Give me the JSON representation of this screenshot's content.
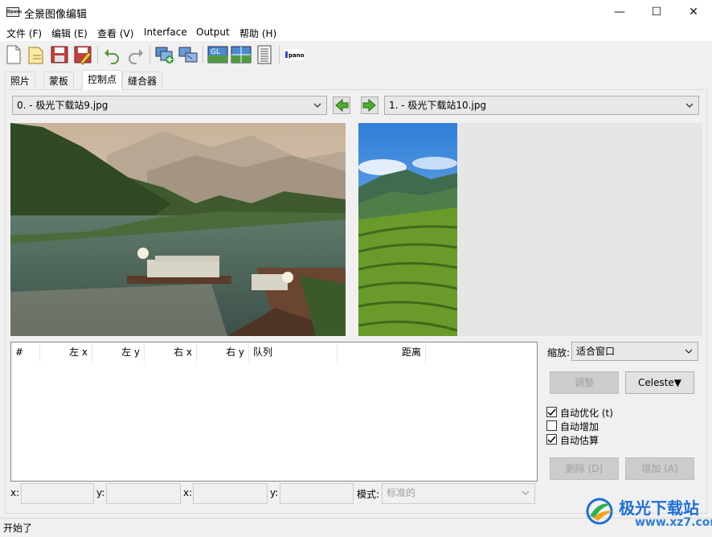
{
  "window": {
    "title": "全景图像编辑",
    "app_icon_text": "Dpano",
    "buttons": {
      "minimize": "—",
      "maximize": "☐",
      "close": "✕"
    }
  },
  "menu": [
    "文件 (F)",
    "编辑 (E)",
    "查看 (V)",
    "Interface",
    "Output",
    "帮助 (H)"
  ],
  "toolbar": {
    "icons": [
      "new-file-icon",
      "open-folder-icon",
      "save-icon",
      "save-as-icon",
      "undo-icon",
      "redo-icon",
      "add-images-icon",
      "align-images-icon",
      "gl-preview-icon",
      "preview-icon",
      "batch-list-icon",
      "pano-logo-icon"
    ],
    "gl_label": "GL",
    "pano_label": "pano"
  },
  "tabs": [
    {
      "label": "照片",
      "active": false
    },
    {
      "label": "蒙板",
      "active": false
    },
    {
      "label": "控制点",
      "active": true
    },
    {
      "label": "缝合器",
      "active": false
    }
  ],
  "left_image_select": "0. - 极光下载站9.jpg",
  "right_image_select": "1. - 极光下载站10.jpg",
  "table": {
    "columns": [
      "#",
      "左 x",
      "左 y",
      "右 x",
      "右 y",
      "队列",
      "距离"
    ],
    "rows": []
  },
  "zoom": {
    "label": "缩放:",
    "value": "适合窗口"
  },
  "buttons": {
    "fine_tune": "调整",
    "celeste": "Celeste▼",
    "delete": "删除 (D)",
    "add": "增加 (A)"
  },
  "checkboxes": [
    {
      "label": "自动优化 (t)",
      "checked": true
    },
    {
      "label": "自动增加",
      "checked": false
    },
    {
      "label": "自动估算",
      "checked": true
    }
  ],
  "coords": {
    "x1_label": "x:",
    "y1_label": "y:",
    "x2_label": "x:",
    "y2_label": "y:",
    "mode_label": "模式:",
    "mode_value": "标准的"
  },
  "status": "开始了",
  "watermark": {
    "name": "极光下载站",
    "url": "www.xz7.com"
  },
  "colors": {
    "accent": "#1e6fd9",
    "arrow_green": "#4caf2a"
  }
}
